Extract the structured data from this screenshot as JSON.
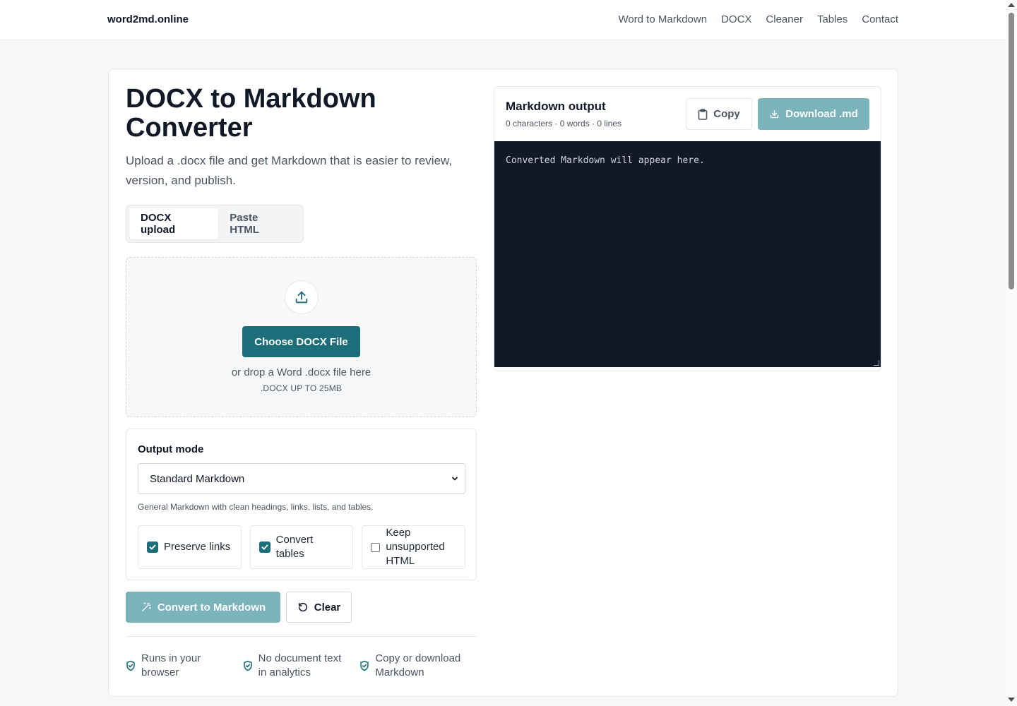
{
  "nav": {
    "brand": "word2md.online",
    "links": [
      "Word to Markdown",
      "DOCX",
      "Cleaner",
      "Tables",
      "Contact"
    ]
  },
  "hero": {
    "title": "DOCX to Markdown Converter",
    "subtitle": "Upload a .docx file and get Markdown that is easier to review, version, and publish."
  },
  "tabs": [
    {
      "label": "DOCX upload",
      "active": true
    },
    {
      "label": "Paste HTML",
      "active": false
    }
  ],
  "dropzone": {
    "button": "Choose DOCX File",
    "hint": "or drop a Word .docx file here",
    "limit": ".DOCX UP TO 25MB"
  },
  "options": {
    "label": "Output mode",
    "selected": "Standard Markdown",
    "description": "General Markdown with clean headings, links, lists, and tables.",
    "checkboxes": [
      {
        "label": "Preserve links",
        "checked": true
      },
      {
        "label": "Convert tables",
        "checked": true
      },
      {
        "label": "Keep unsupported HTML",
        "checked": false
      }
    ]
  },
  "actions": {
    "convert": "Convert to Markdown",
    "clear": "Clear"
  },
  "features": [
    "Runs in your browser",
    "No document text in analytics",
    "Copy or download Markdown"
  ],
  "output": {
    "title": "Markdown output",
    "stats": "0 characters · 0 words · 0 lines",
    "copy": "Copy",
    "download": "Download .md",
    "placeholder": "Converted Markdown will appear here."
  },
  "colors": {
    "accent": "#1c6e7a",
    "accent_disabled": "#7bb3bb",
    "output_bg": "#111827"
  }
}
